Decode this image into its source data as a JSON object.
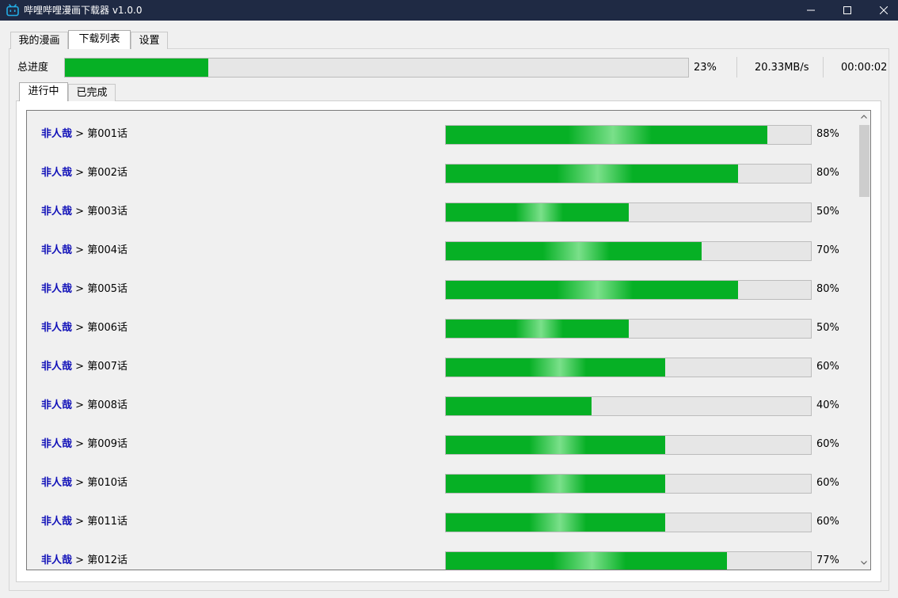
{
  "window": {
    "title": "哔哩哔哩漫画下载器 v1.0.0",
    "icon": "bilibili-tv-icon",
    "controls": [
      "minimize-icon",
      "maximize-icon",
      "close-icon"
    ]
  },
  "tabs": [
    {
      "label": "我的漫画",
      "active": false
    },
    {
      "label": "下载列表",
      "active": true
    },
    {
      "label": "设置",
      "active": false
    }
  ],
  "overall": {
    "label": "总进度",
    "percent_text": "23%",
    "progress": 0.23,
    "speed": "20.33MB/s",
    "elapsed": "00:00:02"
  },
  "subtabs": [
    {
      "label": "进行中",
      "active": true
    },
    {
      "label": "已完成",
      "active": false
    }
  ],
  "colors": {
    "progress_fill": "#06b025",
    "progress_track": "#e6e6e6",
    "series_link": "#1010b8",
    "titlebar": "#1f2a44"
  },
  "downloads": [
    {
      "series": "非人哉",
      "sep": ">",
      "chapter": "第001话",
      "percent_text": "88%",
      "progress": 0.88
    },
    {
      "series": "非人哉",
      "sep": ">",
      "chapter": "第002话",
      "percent_text": "80%",
      "progress": 0.8
    },
    {
      "series": "非人哉",
      "sep": ">",
      "chapter": "第003话",
      "percent_text": "50%",
      "progress": 0.5
    },
    {
      "series": "非人哉",
      "sep": ">",
      "chapter": "第004话",
      "percent_text": "70%",
      "progress": 0.7
    },
    {
      "series": "非人哉",
      "sep": ">",
      "chapter": "第005话",
      "percent_text": "80%",
      "progress": 0.8
    },
    {
      "series": "非人哉",
      "sep": ">",
      "chapter": "第006话",
      "percent_text": "50%",
      "progress": 0.5
    },
    {
      "series": "非人哉",
      "sep": ">",
      "chapter": "第007话",
      "percent_text": "60%",
      "progress": 0.6
    },
    {
      "series": "非人哉",
      "sep": ">",
      "chapter": "第008话",
      "percent_text": "40%",
      "progress": 0.4
    },
    {
      "series": "非人哉",
      "sep": ">",
      "chapter": "第009话",
      "percent_text": "60%",
      "progress": 0.6
    },
    {
      "series": "非人哉",
      "sep": ">",
      "chapter": "第010话",
      "percent_text": "60%",
      "progress": 0.6
    },
    {
      "series": "非人哉",
      "sep": ">",
      "chapter": "第011话",
      "percent_text": "60%",
      "progress": 0.6
    },
    {
      "series": "非人哉",
      "sep": ">",
      "chapter": "第012话",
      "percent_text": "77%",
      "progress": 0.77
    }
  ]
}
